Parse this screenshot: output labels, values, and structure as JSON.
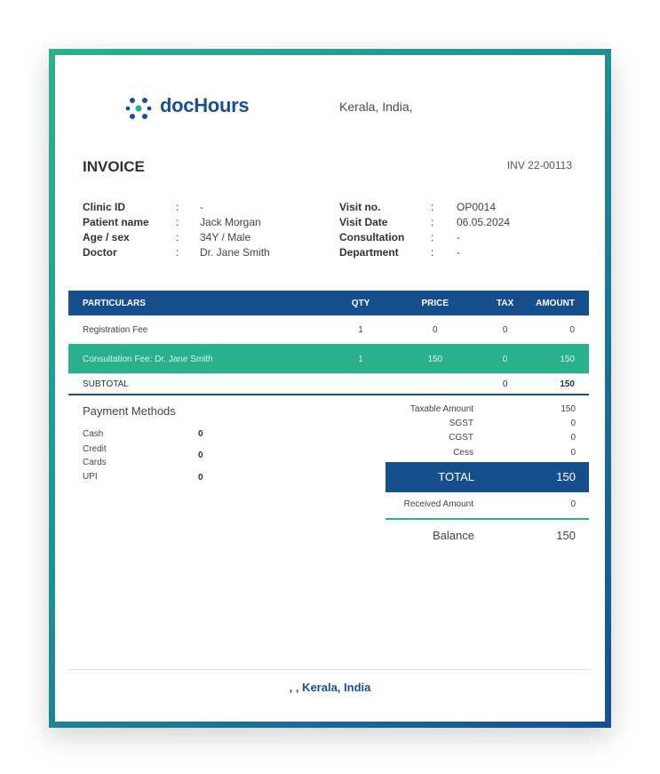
{
  "brand": {
    "name": "docHours",
    "logo_icon": "dots-cluster-icon",
    "location": "Kerala, India,"
  },
  "invoice": {
    "title": "INVOICE",
    "number": "INV 22-00113"
  },
  "patient_info": {
    "clinic_id_label": "Clinic ID",
    "clinic_id_value": "-",
    "patient_name_label": "Patient name",
    "patient_name_value": "Jack Morgan",
    "age_sex_label": "Age / sex",
    "age_sex_value": "34Y / Male",
    "doctor_label": "Doctor",
    "doctor_value": "Dr. Jane Smith",
    "visit_no_label": "Visit no.",
    "visit_no_value": "OP0014",
    "visit_date_label": "Visit Date",
    "visit_date_value": "06.05.2024",
    "consultation_label": "Consultation",
    "consultation_value": "-",
    "department_label": "Department",
    "department_value": "-",
    "separator": ":"
  },
  "table": {
    "headers": [
      "PARTICULARS",
      "QTY",
      "PRICE",
      "TAX",
      "AMOUNT"
    ],
    "rows": [
      {
        "particulars": "Registration Fee",
        "qty": "1",
        "price": "0",
        "tax": "0",
        "amount": "0"
      },
      {
        "particulars": "Consultation Fee: Dr. Jane Smith",
        "qty": "1",
        "price": "150",
        "tax": "0",
        "amount": "150"
      }
    ],
    "subtotal": {
      "label": "SUBTOTAL",
      "tax": "0",
      "amount": "150"
    }
  },
  "payment": {
    "title": "Payment Methods",
    "methods": [
      {
        "label": "Cash",
        "value": "0"
      },
      {
        "label": "Credit\nCards",
        "value": "0"
      },
      {
        "label": "UPI",
        "value": "0"
      }
    ]
  },
  "summary": {
    "taxable_label": "Taxable Amount",
    "taxable_value": "150",
    "sgst_label": "SGST",
    "sgst_value": "0",
    "cgst_label": "CGST",
    "cgst_value": "0",
    "cess_label": "Cess",
    "cess_value": "0",
    "total_label": "TOTAL",
    "total_value": "150",
    "received_label": "Received Amount",
    "received_value": "0",
    "balance_label": "Balance",
    "balance_value": "150"
  },
  "footer": {
    "address": ", , Kerala, India"
  },
  "colors": {
    "primary": "#174f8c",
    "accent": "#2bb08d"
  }
}
